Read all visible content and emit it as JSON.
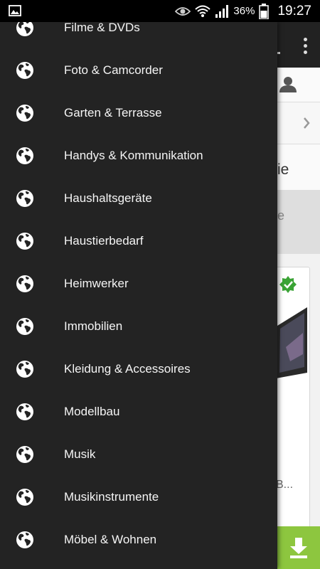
{
  "status_bar": {
    "battery_percent": "36%",
    "time": "19:27",
    "icons": [
      "image-icon",
      "eye-icon",
      "wifi-icon",
      "signal-icon",
      "battery-icon"
    ]
  },
  "drawer": {
    "item_icon": "globe-icon",
    "items": [
      {
        "label": "Filme & DVDs"
      },
      {
        "label": "Foto & Camcorder"
      },
      {
        "label": "Garten & Terrasse"
      },
      {
        "label": "Handys & Kommunikation"
      },
      {
        "label": "Haushaltsgeräte"
      },
      {
        "label": "Haustierbedarf"
      },
      {
        "label": "Heimwerker"
      },
      {
        "label": "Immobilien"
      },
      {
        "label": "Kleidung & Accessoires"
      },
      {
        "label": "Modellbau"
      },
      {
        "label": "Musik"
      },
      {
        "label": "Musikinstrumente"
      },
      {
        "label": "Möbel & Wohnen"
      }
    ]
  },
  "background": {
    "partial_heading": "ie",
    "partial_gray_text": "e",
    "partial_card_text": "B..."
  },
  "colors": {
    "drawer_bg": "#232323",
    "accent_green": "#8dc63f"
  }
}
